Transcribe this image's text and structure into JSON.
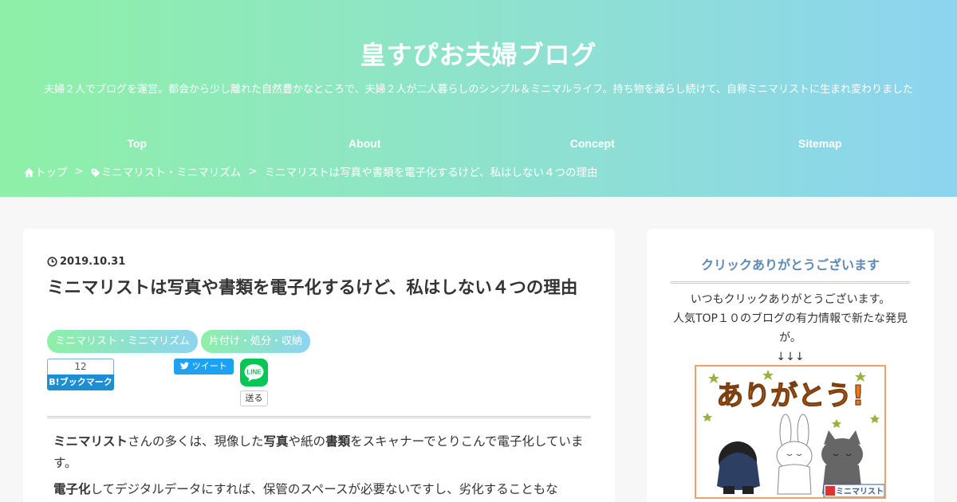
{
  "site": {
    "title": "皇すぴお夫婦ブログ",
    "description": "夫婦２人でブログを運営。都会から少し離れた自然豊かなところで、夫婦２人が二人暮らしのシンプル＆ミニマルライフ。持ち物を減らし続けて、自称ミニマリストに生まれ変わりました"
  },
  "nav": [
    "Top",
    "About",
    "Concept",
    "Sitemap"
  ],
  "breadcrumb": {
    "home": "トップ",
    "separator": ">",
    "category": "ミニマリスト・ミニマリズム",
    "current": "ミニマリストは写真や書類を電子化するけど、私はしない４つの理由"
  },
  "post": {
    "date": "2019.10.31",
    "title": "ミニマリストは写真や書類を電子化するけど、私はしない４つの理由",
    "tags": [
      "ミニマリスト・ミニマリズム",
      "片付け・処分・収納"
    ],
    "share": {
      "hatena_count": "12",
      "hatena_label": "B!ブックマーク",
      "tweet_label": "ツイート",
      "line_label": "LINE",
      "send_label": "送る"
    },
    "paragraphs": [
      [
        {
          "t": "ミニマリスト",
          "b": true
        },
        {
          "t": "さんの多くは、現像した",
          "b": false
        },
        {
          "t": "写真",
          "b": true
        },
        {
          "t": "や紙の",
          "b": false
        },
        {
          "t": "書類",
          "b": true
        },
        {
          "t": "をスキャナーでとりこんで電子化しています。",
          "b": false
        }
      ],
      [
        {
          "t": "電子化",
          "b": true
        },
        {
          "t": "してデジタルデータにすれば、保管のスペースが必要ないですし、劣化することもな",
          "b": false
        }
      ]
    ]
  },
  "sidebar": {
    "widget_title": "クリックありがとうございます",
    "lines": [
      "いつもクリックありがとうございます。",
      "人気TOP１０のブログの有力情報で新たな発見が。",
      "↓↓↓"
    ],
    "image_text": "ありがとう!",
    "image_badge": "ミニマリスト"
  },
  "colors": {
    "header_start": "#8ef0a7",
    "header_end": "#8dd4f0",
    "widget_title": "#5f8ab8",
    "hatena": "#1e8ed2",
    "twitter": "#1da1f2",
    "line": "#06c755"
  }
}
